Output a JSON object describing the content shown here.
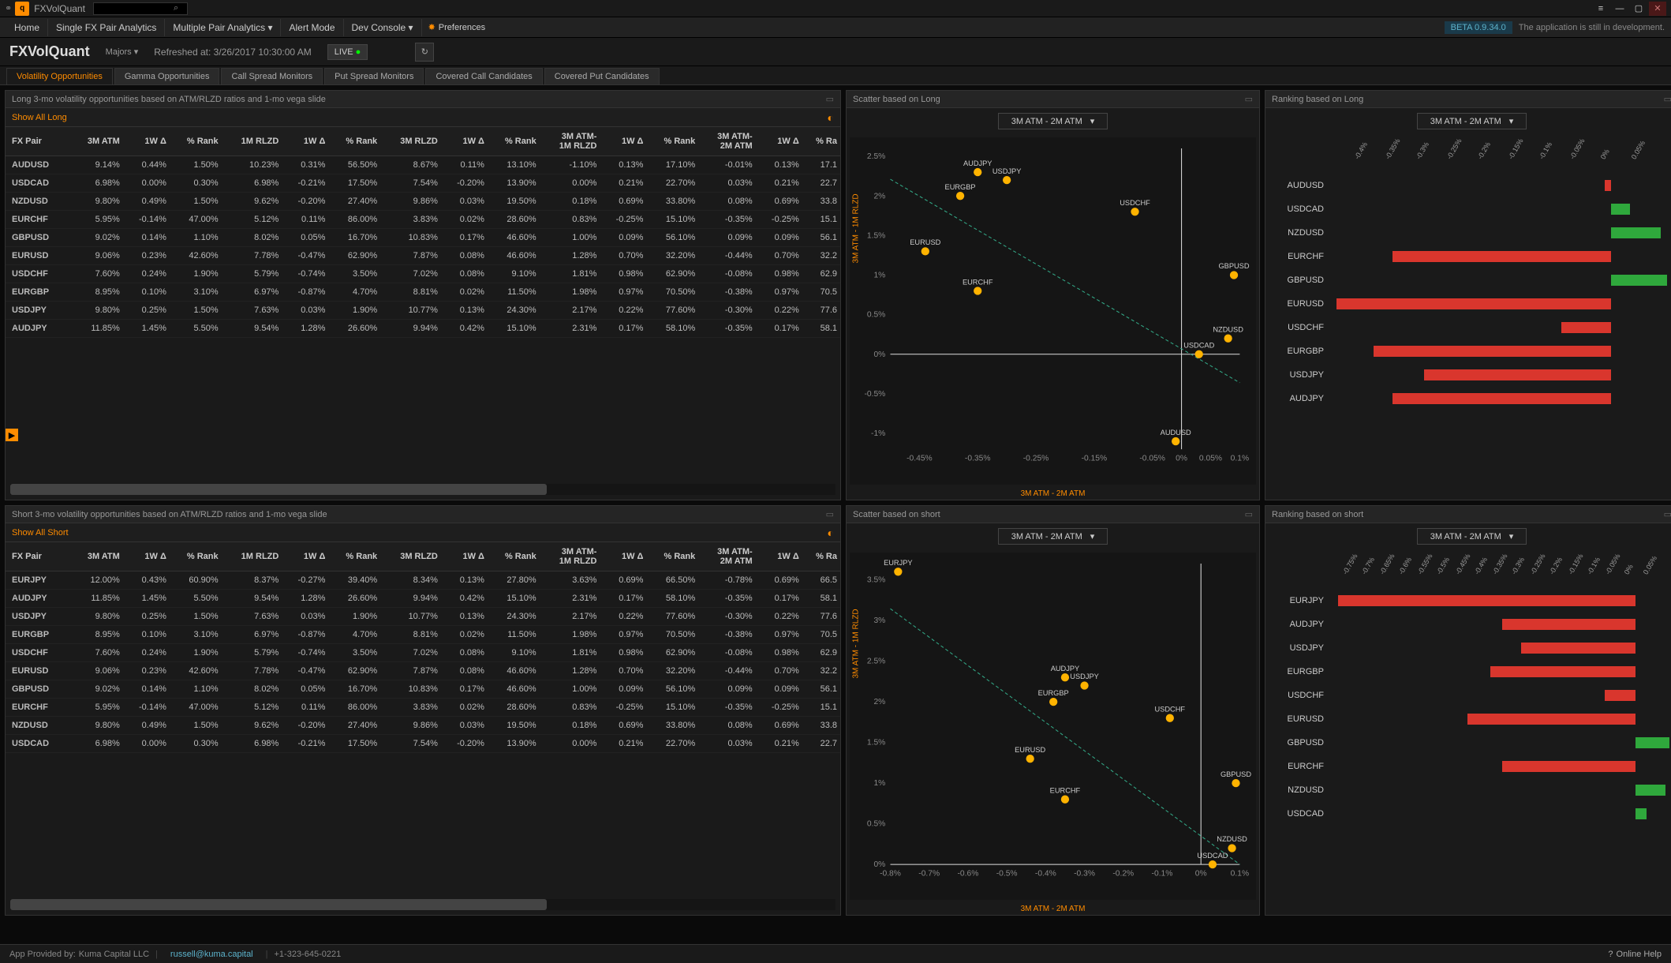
{
  "app": {
    "title": "FXVolQuant",
    "beta": "BETA  0.9.34.0",
    "dev_msg": "The application is still in development."
  },
  "menu": {
    "home": "Home",
    "single": "Single FX Pair Analytics",
    "multi": "Multiple Pair Analytics ▾",
    "alert": "Alert Mode",
    "dev": "Dev Console ▾",
    "prefs": "Preferences"
  },
  "subtitle": {
    "brand": "FXVolQuant",
    "group": "Majors ▾",
    "refreshed": "Refreshed at: 3/26/2017 10:30:00 AM",
    "live": "LIVE"
  },
  "tabs": [
    "Volatility Opportunities",
    "Gamma Opportunities",
    "Call Spread Monitors",
    "Put Spread Monitors",
    "Covered Call Candidates",
    "Covered Put Candidates"
  ],
  "panels": {
    "long_tbl": "Long 3-mo volatility opportunities based on ATM/RLZD ratios and 1-mo vega slide",
    "short_tbl": "Short 3-mo volatility opportunities based on ATM/RLZD ratios and 1-mo vega slide",
    "long_sc": "Scatter based on Long",
    "short_sc": "Scatter based on short",
    "long_rk": "Ranking based on Long",
    "short_rk": "Ranking based on short",
    "show_long": "Show All Long",
    "show_short": "Show All Short",
    "sel": "3M ATM - 2M ATM",
    "y_axis": "3M ATM - 1M RLZD",
    "x_axis": "3M ATM - 2M ATM"
  },
  "cols": [
    "FX Pair",
    "3M ATM",
    "1W Δ",
    "% Rank",
    "1M RLZD",
    "1W Δ",
    "% Rank",
    "3M RLZD",
    "1W Δ",
    "% Rank",
    "3M ATM-\n1M RLZD",
    "1W Δ",
    "% Rank",
    "3M ATM-\n2M ATM",
    "1W Δ",
    "% Ra"
  ],
  "long_rows": [
    [
      "AUDUSD",
      "9.14%",
      "+0.44%",
      "1.50%",
      "10.23%",
      "+0.31%",
      "56.50%",
      "8.67%",
      "+0.11%",
      "13.10%",
      "-1.10%",
      "+0.13%",
      "17.10%",
      "-0.01%",
      "+0.13%",
      "17.1"
    ],
    [
      "USDCAD",
      "6.98%",
      "0.00%",
      "0.30%",
      "6.98%",
      "-0.21%",
      "17.50%",
      "7.54%",
      "-0.20%",
      "13.90%",
      "0.00%",
      "+0.21%",
      "22.70%",
      "0.03%",
      "+0.21%",
      "22.7"
    ],
    [
      "NZDUSD",
      "9.80%",
      "+0.49%",
      "1.50%",
      "9.62%",
      "-0.20%",
      "27.40%",
      "9.86%",
      "+0.03%",
      "19.50%",
      "0.18%",
      "+0.69%",
      "33.80%",
      "0.08%",
      "+0.69%",
      "33.8"
    ],
    [
      "EURCHF",
      "5.95%",
      "-0.14%",
      "47.00%",
      "5.12%",
      "+0.11%",
      "86.00%",
      "3.83%",
      "+0.02%",
      "28.60%",
      "0.83%",
      "-0.25%",
      "15.10%",
      "-0.35%",
      "-0.25%",
      "15.1"
    ],
    [
      "GBPUSD",
      "9.02%",
      "+0.14%",
      "1.10%",
      "8.02%",
      "+0.05%",
      "16.70%",
      "10.83%",
      "+0.17%",
      "46.60%",
      "1.00%",
      "+0.09%",
      "56.10%",
      "0.09%",
      "+0.09%",
      "56.1"
    ],
    [
      "EURUSD",
      "9.06%",
      "+0.23%",
      "42.60%",
      "7.78%",
      "-0.47%",
      "62.90%",
      "7.87%",
      "+0.08%",
      "46.60%",
      "1.28%",
      "+0.70%",
      "32.20%",
      "-0.44%",
      "+0.70%",
      "32.2"
    ],
    [
      "USDCHF",
      "7.60%",
      "+0.24%",
      "1.90%",
      "5.79%",
      "-0.74%",
      "3.50%",
      "7.02%",
      "+0.08%",
      "9.10%",
      "1.81%",
      "+0.98%",
      "62.90%",
      "-0.08%",
      "+0.98%",
      "62.9"
    ],
    [
      "EURGBP",
      "8.95%",
      "+0.10%",
      "3.10%",
      "6.97%",
      "-0.87%",
      "4.70%",
      "8.81%",
      "+0.02%",
      "11.50%",
      "1.98%",
      "+0.97%",
      "70.50%",
      "-0.38%",
      "+0.97%",
      "70.5"
    ],
    [
      "USDJPY",
      "9.80%",
      "+0.25%",
      "1.50%",
      "7.63%",
      "+0.03%",
      "1.90%",
      "10.77%",
      "+0.13%",
      "24.30%",
      "2.17%",
      "+0.22%",
      "77.60%",
      "-0.30%",
      "+0.22%",
      "77.6"
    ],
    [
      "AUDJPY",
      "11.85%",
      "+1.45%",
      "5.50%",
      "9.54%",
      "+1.28%",
      "26.60%",
      "9.94%",
      "+0.42%",
      "15.10%",
      "2.31%",
      "+0.17%",
      "58.10%",
      "-0.35%",
      "+0.17%",
      "58.1"
    ]
  ],
  "short_rows": [
    [
      "EURJPY",
      "12.00%",
      "+0.43%",
      "60.90%",
      "8.37%",
      "-0.27%",
      "39.40%",
      "8.34%",
      "+0.13%",
      "27.80%",
      "3.63%",
      "+0.69%",
      "66.50%",
      "-0.78%",
      "+0.69%",
      "66.5"
    ],
    [
      "AUDJPY",
      "11.85%",
      "+1.45%",
      "5.50%",
      "9.54%",
      "+1.28%",
      "26.60%",
      "9.94%",
      "+0.42%",
      "15.10%",
      "2.31%",
      "+0.17%",
      "58.10%",
      "-0.35%",
      "+0.17%",
      "58.1"
    ],
    [
      "USDJPY",
      "9.80%",
      "+0.25%",
      "1.50%",
      "7.63%",
      "+0.03%",
      "1.90%",
      "10.77%",
      "+0.13%",
      "24.30%",
      "2.17%",
      "+0.22%",
      "77.60%",
      "-0.30%",
      "+0.22%",
      "77.6"
    ],
    [
      "EURGBP",
      "8.95%",
      "+0.10%",
      "3.10%",
      "6.97%",
      "-0.87%",
      "4.70%",
      "8.81%",
      "+0.02%",
      "11.50%",
      "1.98%",
      "+0.97%",
      "70.50%",
      "-0.38%",
      "+0.97%",
      "70.5"
    ],
    [
      "USDCHF",
      "7.60%",
      "+0.24%",
      "1.90%",
      "5.79%",
      "-0.74%",
      "3.50%",
      "7.02%",
      "+0.08%",
      "9.10%",
      "1.81%",
      "+0.98%",
      "62.90%",
      "-0.08%",
      "+0.98%",
      "62.9"
    ],
    [
      "EURUSD",
      "9.06%",
      "+0.23%",
      "42.60%",
      "7.78%",
      "-0.47%",
      "62.90%",
      "7.87%",
      "+0.08%",
      "46.60%",
      "1.28%",
      "+0.70%",
      "32.20%",
      "-0.44%",
      "+0.70%",
      "32.2"
    ],
    [
      "GBPUSD",
      "9.02%",
      "+0.14%",
      "1.10%",
      "8.02%",
      "+0.05%",
      "16.70%",
      "10.83%",
      "+0.17%",
      "46.60%",
      "1.00%",
      "+0.09%",
      "56.10%",
      "0.09%",
      "+0.09%",
      "56.1"
    ],
    [
      "EURCHF",
      "5.95%",
      "-0.14%",
      "47.00%",
      "5.12%",
      "+0.11%",
      "86.00%",
      "3.83%",
      "+0.02%",
      "28.60%",
      "0.83%",
      "-0.25%",
      "15.10%",
      "-0.35%",
      "-0.25%",
      "15.1"
    ],
    [
      "NZDUSD",
      "9.80%",
      "+0.49%",
      "1.50%",
      "9.62%",
      "-0.20%",
      "27.40%",
      "9.86%",
      "+0.03%",
      "19.50%",
      "0.18%",
      "+0.69%",
      "33.80%",
      "0.08%",
      "+0.69%",
      "33.8"
    ],
    [
      "USDCAD",
      "6.98%",
      "0.00%",
      "0.30%",
      "6.98%",
      "-0.21%",
      "17.50%",
      "7.54%",
      "-0.20%",
      "13.90%",
      "0.00%",
      "+0.21%",
      "22.70%",
      "0.03%",
      "+0.21%",
      "22.7"
    ]
  ],
  "chart_data": {
    "long_scatter": {
      "type": "scatter",
      "xlabel": "3M ATM - 2M ATM",
      "ylabel": "3M ATM - 1M RLZD",
      "xlim": [
        -0.5,
        0.1
      ],
      "ylim": [
        -1.2,
        2.6
      ],
      "xticks": [
        "-0.45%",
        "-0.35%",
        "-0.25%",
        "-0.15%",
        "-0.05%",
        "0%",
        "0.05%",
        "0.1%"
      ],
      "yticks": [
        "-1%",
        "-0.5%",
        "0%",
        "0.5%",
        "1%",
        "1.5%",
        "2%",
        "2.5%"
      ],
      "points": [
        {
          "name": "AUDJPY",
          "x": -0.35,
          "y": 2.3
        },
        {
          "name": "USDJPY",
          "x": -0.3,
          "y": 2.2
        },
        {
          "name": "EURGBP",
          "x": -0.38,
          "y": 2.0
        },
        {
          "name": "USDCHF",
          "x": -0.08,
          "y": 1.8
        },
        {
          "name": "EURUSD",
          "x": -0.44,
          "y": 1.3
        },
        {
          "name": "GBPUSD",
          "x": 0.09,
          "y": 1.0
        },
        {
          "name": "EURCHF",
          "x": -0.35,
          "y": 0.8
        },
        {
          "name": "NZDUSD",
          "x": 0.08,
          "y": 0.2
        },
        {
          "name": "USDCAD",
          "x": 0.03,
          "y": 0.0
        },
        {
          "name": "AUDUSD",
          "x": -0.01,
          "y": -1.1
        }
      ]
    },
    "short_scatter": {
      "type": "scatter",
      "xlabel": "3M ATM - 2M ATM",
      "ylabel": "3M ATM - 1M RLZD",
      "xlim": [
        -0.8,
        0.1
      ],
      "ylim": [
        0,
        3.7
      ],
      "xticks": [
        "-0.8%",
        "-0.7%",
        "-0.6%",
        "-0.5%",
        "-0.4%",
        "-0.3%",
        "-0.2%",
        "-0.1%",
        "0%",
        "0.1%"
      ],
      "yticks": [
        "0%",
        "0.5%",
        "1%",
        "1.5%",
        "2%",
        "2.5%",
        "3%",
        "3.5%"
      ],
      "points": [
        {
          "name": "EURJPY",
          "x": -0.78,
          "y": 3.6
        },
        {
          "name": "AUDJPY",
          "x": -0.35,
          "y": 2.3
        },
        {
          "name": "USDJPY",
          "x": -0.3,
          "y": 2.2
        },
        {
          "name": "EURGBP",
          "x": -0.38,
          "y": 2.0
        },
        {
          "name": "USDCHF",
          "x": -0.08,
          "y": 1.8
        },
        {
          "name": "EURUSD",
          "x": -0.44,
          "y": 1.3
        },
        {
          "name": "GBPUSD",
          "x": 0.09,
          "y": 1.0
        },
        {
          "name": "EURCHF",
          "x": -0.35,
          "y": 0.8
        },
        {
          "name": "NZDUSD",
          "x": 0.08,
          "y": 0.2
        },
        {
          "name": "USDCAD",
          "x": 0.03,
          "y": 0.0
        }
      ]
    },
    "long_rank": {
      "type": "bar",
      "xlim": [
        -0.45,
        0.1
      ],
      "ticks": [
        "-0.4%",
        "-0.35%",
        "-0.3%",
        "-0.25%",
        "-0.2%",
        "-0.15%",
        "-0.1%",
        "-0.05%",
        "0%",
        "0.05%"
      ],
      "series": [
        {
          "name": "AUDUSD",
          "value": -0.01,
          "color": "red"
        },
        {
          "name": "USDCAD",
          "value": 0.03,
          "color": "green"
        },
        {
          "name": "NZDUSD",
          "value": 0.08,
          "color": "green"
        },
        {
          "name": "EURCHF",
          "value": -0.35,
          "color": "red"
        },
        {
          "name": "GBPUSD",
          "value": 0.09,
          "color": "green"
        },
        {
          "name": "EURUSD",
          "value": -0.44,
          "color": "red"
        },
        {
          "name": "USDCHF",
          "value": -0.08,
          "color": "red"
        },
        {
          "name": "EURGBP",
          "value": -0.38,
          "color": "red"
        },
        {
          "name": "USDJPY",
          "value": -0.3,
          "color": "red"
        },
        {
          "name": "AUDJPY",
          "value": -0.35,
          "color": "red"
        }
      ]
    },
    "short_rank": {
      "type": "bar",
      "xlim": [
        -0.8,
        0.1
      ],
      "ticks": [
        "-0.75%",
        "-0.7%",
        "-0.65%",
        "-0.6%",
        "-0.55%",
        "-0.5%",
        "-0.45%",
        "-0.4%",
        "-0.35%",
        "-0.3%",
        "-0.25%",
        "-0.2%",
        "-0.15%",
        "-0.1%",
        "-0.05%",
        "0%",
        "0.05%"
      ],
      "series": [
        {
          "name": "EURJPY",
          "value": -0.78,
          "color": "red"
        },
        {
          "name": "AUDJPY",
          "value": -0.35,
          "color": "red"
        },
        {
          "name": "USDJPY",
          "value": -0.3,
          "color": "red"
        },
        {
          "name": "EURGBP",
          "value": -0.38,
          "color": "red"
        },
        {
          "name": "USDCHF",
          "value": -0.08,
          "color": "red"
        },
        {
          "name": "EURUSD",
          "value": -0.44,
          "color": "red"
        },
        {
          "name": "GBPUSD",
          "value": 0.09,
          "color": "green"
        },
        {
          "name": "EURCHF",
          "value": -0.35,
          "color": "red"
        },
        {
          "name": "NZDUSD",
          "value": 0.08,
          "color": "green"
        },
        {
          "name": "USDCAD",
          "value": 0.03,
          "color": "green"
        }
      ]
    }
  },
  "footer": {
    "provider": "App Provided by:",
    "company": "Kuma Capital LLC",
    "email": "russell@kuma.capital",
    "phone": "+1-323-645-0221",
    "help": "Online Help"
  }
}
